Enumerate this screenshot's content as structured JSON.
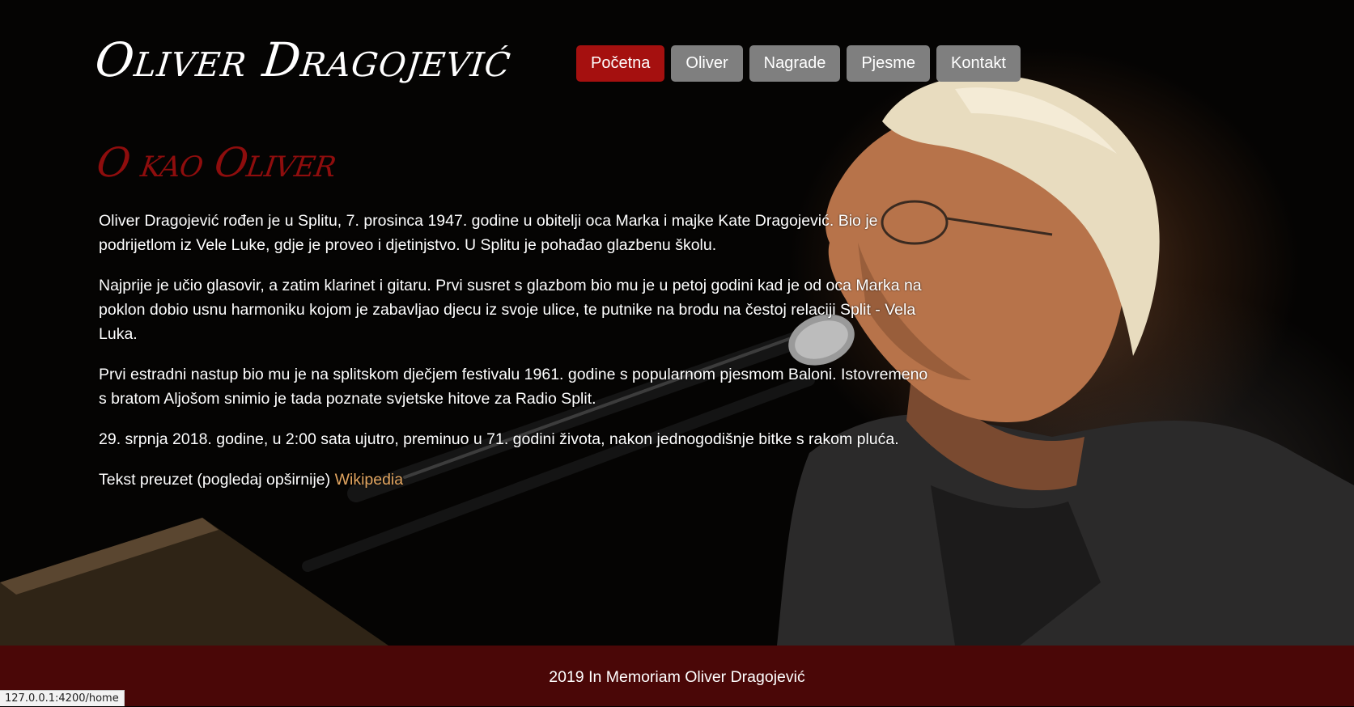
{
  "header": {
    "logo": "Oliver Dragojević",
    "nav": [
      {
        "label": "Početna",
        "active": true
      },
      {
        "label": "Oliver",
        "active": false
      },
      {
        "label": "Nagrade",
        "active": false
      },
      {
        "label": "Pjesme",
        "active": false
      },
      {
        "label": "Kontakt",
        "active": false
      }
    ]
  },
  "main": {
    "heading": "O kao Oliver",
    "paragraphs": [
      "Oliver Dragojević rođen je u Splitu, 7. prosinca 1947. godine u obitelji oca Marka i majke Kate Dragojević. Bio je podrijetlom iz Vele Luke, gdje je proveo i djetinjstvo. U Splitu je pohađao glazbenu školu.",
      "Najprije je učio glasovir, a zatim klarinet i gitaru. Prvi susret s glazbom bio mu je u petoj godini kad je od oca Marka na poklon dobio usnu harmoniku kojom je zabavljao djecu iz svoje ulice, te putnike na brodu na čestoj relaciji Split - Vela Luka.",
      "Prvi estradni nastup bio mu je na splitskom dječjem festivalu 1961. godine s popularnom pjesmom Baloni. Istovremeno s bratom Aljošom snimio je tada poznate svjetske hitove za Radio Split.",
      "29. srpnja 2018. godine, u 2:00 sata ujutro, preminuo u 71. godini života, nakon jednogodišnje bitke s rakom pluća."
    ],
    "source_prefix": "Tekst preuzet (pogledaj opširnije) ",
    "source_link": "Wikipedia"
  },
  "footer": {
    "text": "2019 In Memoriam Oliver Dragojević"
  },
  "statusbar": {
    "url": "127.0.0.1:4200/home"
  },
  "colors": {
    "nav_active": "#a5100f",
    "nav_inactive": "#7f7f7f",
    "heading": "#8e0d0d",
    "link": "#e2a560",
    "footer_bg": "#4a0707"
  }
}
